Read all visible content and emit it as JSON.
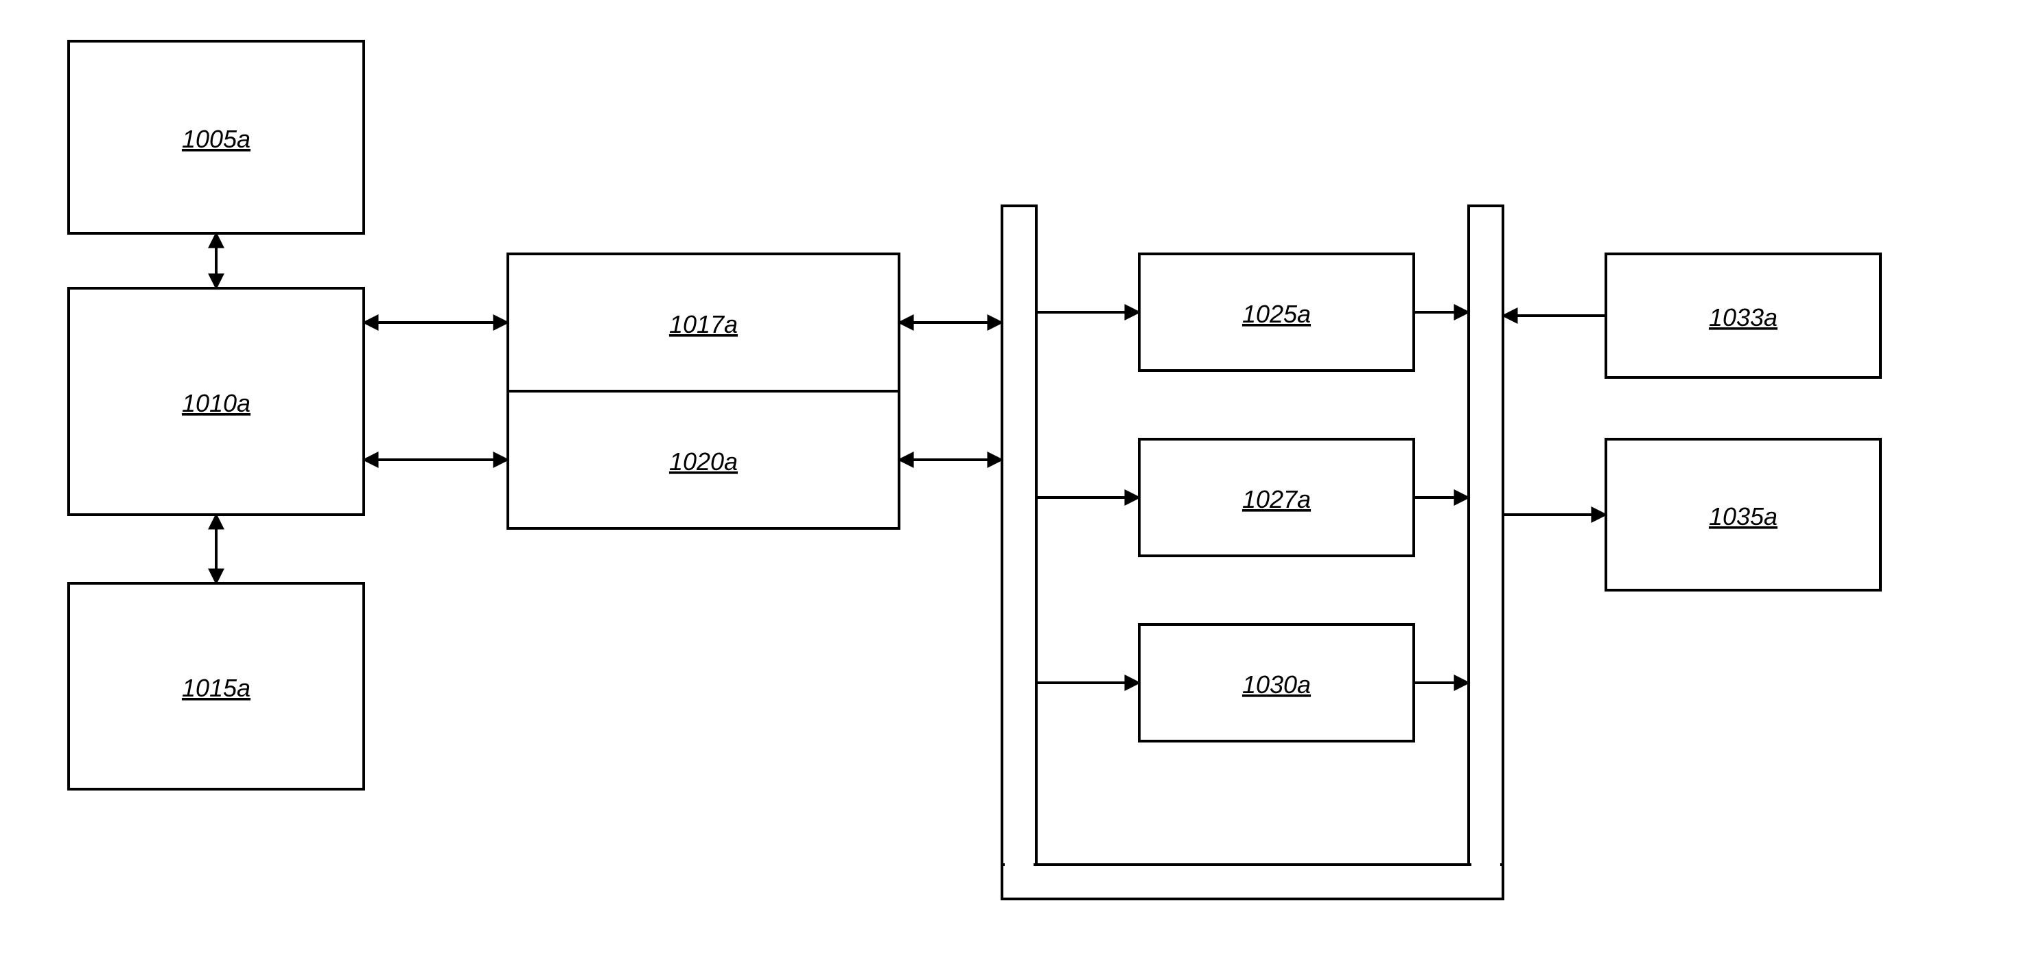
{
  "labels": {
    "b1005": "1005a",
    "b1010": "1010a",
    "b1015": "1015a",
    "b1017": "1017a",
    "b1020": "1020a",
    "b1025": "1025a",
    "b1027": "1027a",
    "b1030": "1030a",
    "b1033": "1033a",
    "b1035": "1035a"
  }
}
